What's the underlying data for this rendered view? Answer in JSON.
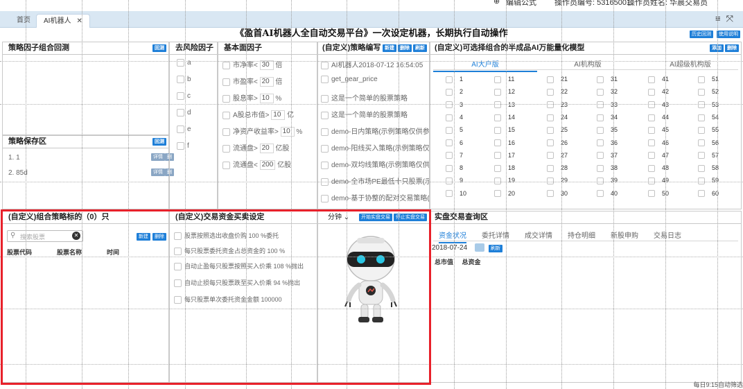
{
  "topbar": {
    "item1": "编辑公式",
    "item2": "操作员编号: 53165001",
    "item3": "操作员姓名: 华晨交易员"
  },
  "tabs": [
    {
      "label": "首页"
    },
    {
      "label": "AI机器人"
    }
  ],
  "window_icons": {
    "menu": "menu-icon",
    "fullscreen": "fullscreen-icon"
  },
  "banner": {
    "title": "《盈首AI机器人全自动交易平台》一次设定机器，长期执行自动操作",
    "history_label": "历史回测",
    "help_label": "使用说明"
  },
  "backtest_panel": {
    "title": "策略因子组合回测",
    "btn": "回测"
  },
  "save_panel": {
    "title": "策略保存区",
    "btn": "回测",
    "items": [
      {
        "label": "1. 1",
        "detail": "详情",
        "del": "删"
      },
      {
        "label": "2. 85d",
        "detail": "详情",
        "del": "删"
      }
    ]
  },
  "risk_panel": {
    "title": "去风险因子",
    "items": [
      "a",
      "b",
      "c",
      "d",
      "e",
      "f"
    ]
  },
  "fund_panel": {
    "title": "基本面因子",
    "items": [
      {
        "pre": "市净率<",
        "val": "30",
        "unit": "倍"
      },
      {
        "pre": "市盈率<",
        "val": "20",
        "unit": "倍"
      },
      {
        "pre": "股息率>",
        "val": "10",
        "unit": "%"
      },
      {
        "pre": "A股总市值>",
        "val": "10",
        "unit": "亿"
      },
      {
        "pre": "净资产收益率>",
        "val": "10",
        "unit": "%"
      },
      {
        "pre": "流通盘>",
        "val": "20",
        "unit": "亿股"
      },
      {
        "pre": "流通盘<",
        "val": "200",
        "unit": "亿股"
      }
    ]
  },
  "strategy_panel": {
    "title": "(自定义)策略编写",
    "new": "新建",
    "del": "删除",
    "refresh": "刷新",
    "items": [
      "AI机器人2018-07-12 16:54:05",
      "get_gear_price",
      "这是一个简单的股票策略",
      "这是一个简单的股票策略",
      "demo-日内策略(示例策略仅供参考",
      "demo-阳线买入策略(示例策略仅供",
      "demo-双均线策略(示例策略仅供参",
      "demo-全市场PE最低十只股票(示例",
      "demo-基于协整的配对交易策略(示"
    ]
  },
  "model_panel": {
    "title": "(自定义)可选择组合的半成品AI万能量化模型",
    "add": "添加",
    "del": "删除",
    "tabs": [
      "AI大户版",
      "AI机构版",
      "AI超级机构版"
    ],
    "columns": [
      [
        "1",
        "2",
        "3",
        "4",
        "5",
        "6",
        "7",
        "8",
        "9",
        "10"
      ],
      [
        "11",
        "12",
        "13",
        "14",
        "15",
        "16",
        "17",
        "18",
        "19",
        "20"
      ],
      [
        "21",
        "22",
        "23",
        "24",
        "25",
        "26",
        "27",
        "28",
        "29",
        "30"
      ],
      [
        "31",
        "32",
        "33",
        "34",
        "35",
        "36",
        "37",
        "38",
        "39",
        "40"
      ],
      [
        "41",
        "42",
        "43",
        "44",
        "45",
        "46",
        "47",
        "48",
        "49",
        "50"
      ],
      [
        "51",
        "52",
        "53",
        "54",
        "55",
        "56",
        "57",
        "58",
        "59",
        "60"
      ]
    ]
  },
  "combo_panel": {
    "title": "(自定义)组合策略标的（0）只",
    "search_placeholder": "搜索股票",
    "new": "新建",
    "del": "删除",
    "columns": [
      "股票代码",
      "股票名称",
      "时间"
    ]
  },
  "trade_panel": {
    "title": "(自定义)交易资金买卖设定",
    "items": [
      {
        "pre": "股票按照选出收盘价购",
        "val": "100",
        "unit": "%委托"
      },
      {
        "pre": "每只股票委托资金占总资金的",
        "val": "100",
        "unit": "%"
      },
      {
        "pre": "自动止盈每只股票按照买入价乘",
        "val": "108",
        "unit": "%抛出"
      },
      {
        "pre": "自动止损每只股票跌至买入价乘",
        "val": "94",
        "unit": "%抛出"
      },
      {
        "pre": "每只股票单次委托资金金额",
        "val": "100000",
        "unit": ""
      }
    ]
  },
  "robot_panel": {
    "period": "分钟",
    "start": "开始实盘交易",
    "stop": "停止实盘交易"
  },
  "query_panel": {
    "title": "实盘交易查询区",
    "tabs": [
      "资金状况",
      "委托详情",
      "成交详情",
      "持仓明细",
      "新股申购",
      "交易日志"
    ],
    "date": "2018-07-24",
    "refresh": "刷新",
    "columns": [
      "总市值",
      "总资金"
    ]
  },
  "footer": {
    "text": "每日9:15自动筛选"
  },
  "colors": {
    "accent": "#1e7fd8",
    "highlight": "#e8202a",
    "tabbar": "#d9e7f3"
  }
}
